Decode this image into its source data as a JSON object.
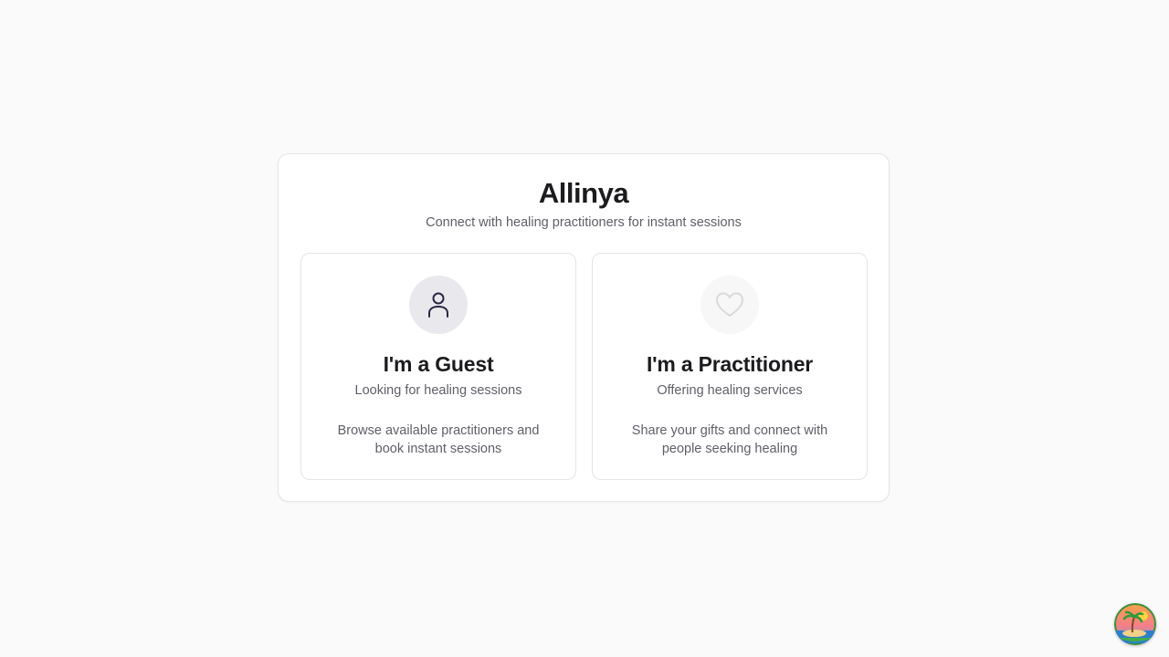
{
  "app": {
    "title": "Allinya",
    "subtitle": "Connect with healing practitioners for instant sessions"
  },
  "options": [
    {
      "title": "I'm a Guest",
      "subtitle": "Looking for healing sessions",
      "description": "Browse available practitioners and book instant sessions",
      "icon": "user-icon"
    },
    {
      "title": "I'm a Practitioner",
      "subtitle": "Offering healing services",
      "description": "Share your gifts and connect with people seeking healing",
      "icon": "heart-icon"
    }
  ],
  "corner_badge": {
    "icon": "island-palm-icon"
  },
  "colors": {
    "background": "#fafafa",
    "card": "#ffffff",
    "border": "#e4e4e7",
    "text": "#1c1c1f",
    "muted_text": "#5f6068",
    "guest_icon_bg": "#e9e8ed",
    "guest_icon_stroke": "#2a2740",
    "practitioner_icon_bg": "#f7f7f8",
    "practitioner_icon_stroke": "#d9d9dd"
  }
}
